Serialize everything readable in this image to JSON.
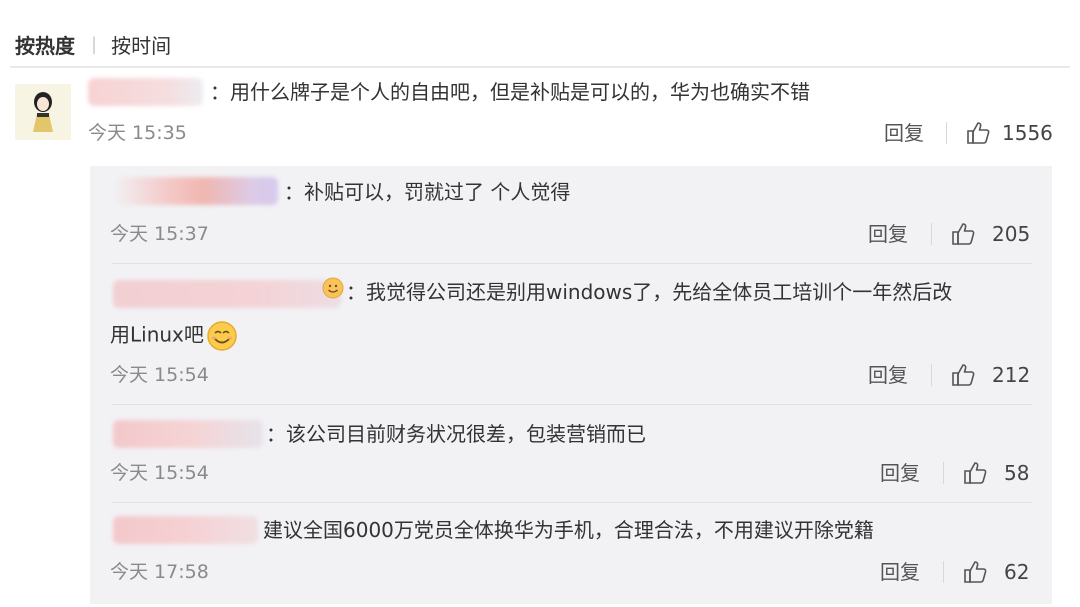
{
  "sort": {
    "active": "按热度",
    "inactive": "按时间"
  },
  "comment": {
    "text": "：用什么牌子是个人的自由吧，但是补贴是可以的，华为也确实不错",
    "time": "今天 15:35",
    "reply_label": "回复",
    "likes": "1556"
  },
  "replies": [
    {
      "text": "：补贴可以，罚就过了  个人觉得",
      "time": "今天 15:37",
      "reply_label": "回复",
      "likes": "205"
    },
    {
      "text_line1": "：我觉得公司还是别用windows了，先给全体员工培训个一年然后改",
      "text_line2": "用Linux吧",
      "time": "今天 15:54",
      "reply_label": "回复",
      "likes": "212"
    },
    {
      "text": "：该公司目前财务状况很差，包装营销而已",
      "time": "今天 15:54",
      "reply_label": "回复",
      "likes": "58"
    },
    {
      "text": "建议全国6000万党员全体换华为手机，合理合法，不用建议开除党籍",
      "time": "今天 17:58",
      "reply_label": "回复",
      "likes": "62"
    }
  ],
  "icons": {
    "like": "thumbs-up-icon",
    "emoji": "smile-emoji-icon"
  },
  "colors": {
    "reply_bg": "#f2f2f5",
    "time": "#8a8a8a",
    "blur_pink": "#f3c9cf"
  }
}
